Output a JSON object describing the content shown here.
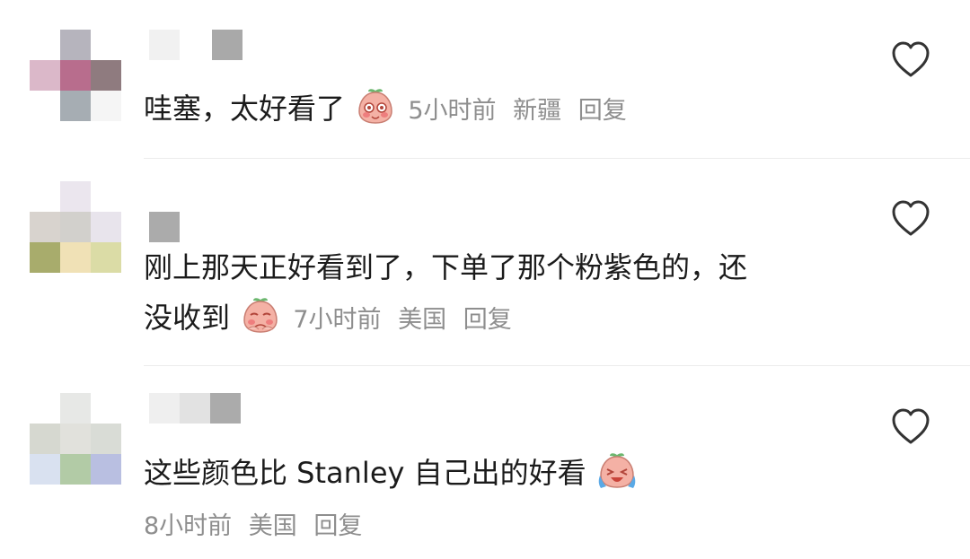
{
  "comments": [
    {
      "text": "哇塞，太好看了",
      "emoji": "blushing-bun-emoji",
      "time": "5小时前",
      "location": "新疆",
      "reply": "回复"
    },
    {
      "text_line1": "刚上那天正好看到了，下单了那个粉紫色的，还",
      "text_line2": "没收到",
      "emoji": "pleading-bun-emoji",
      "time": "7小时前",
      "location": "美国",
      "reply": "回复"
    },
    {
      "text": "这些颜色比 Stanley 自己出的好看",
      "emoji": "laughing-tears-bun-emoji",
      "time": "8小时前",
      "location": "美国",
      "reply": "回复"
    }
  ],
  "icons": {
    "like": "heart-outline-icon"
  },
  "colors": {
    "meta": "#8e8e8e",
    "divider": "#ececec",
    "text": "#1b1b1b"
  }
}
